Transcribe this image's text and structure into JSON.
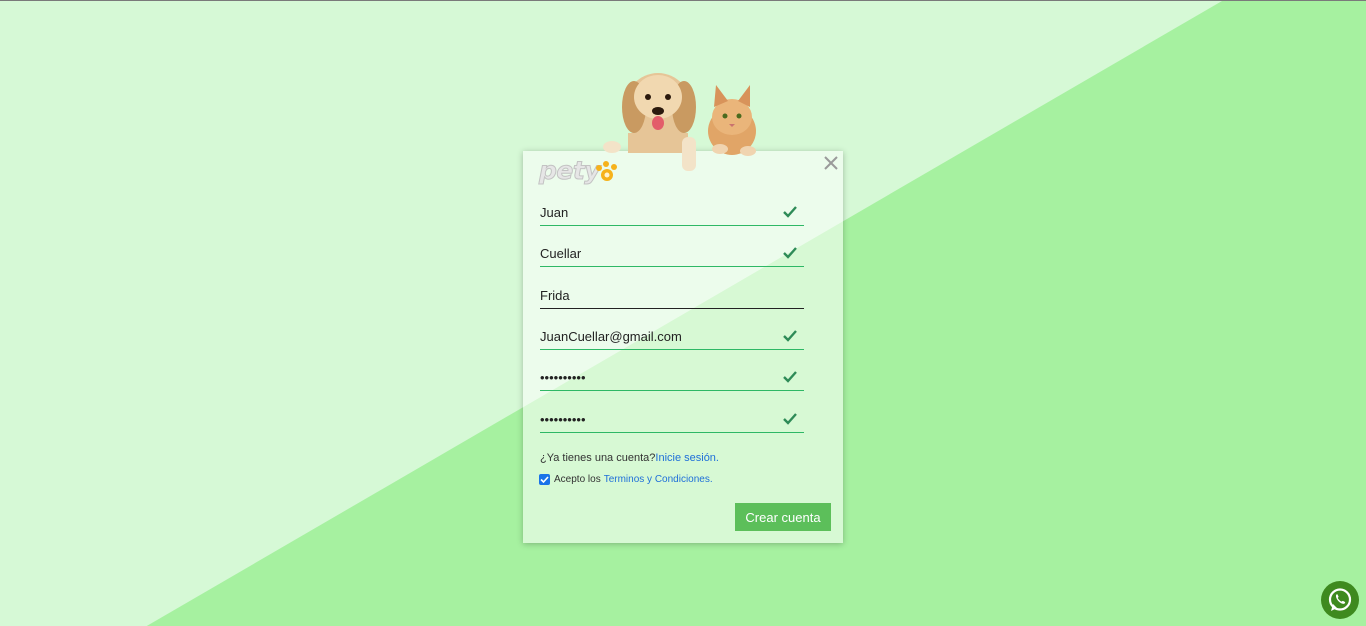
{
  "brand": {
    "logo_text": "pety",
    "accent": "#5cbf5a",
    "background_light": "#d6f9d6",
    "background_dark": "#a6f1a0"
  },
  "form": {
    "fields": [
      {
        "value": "Juan",
        "valid": true
      },
      {
        "value": "Cuellar",
        "valid": true
      },
      {
        "value": "Frida",
        "valid": false
      },
      {
        "value": "JuanCuellar@gmail.com",
        "valid": true
      },
      {
        "value": "••••••••••",
        "valid": true
      },
      {
        "value": "••••••••••",
        "valid": true
      }
    ],
    "have_account_text": "¿Ya tienes una cuenta?",
    "login_link": "Inicie sesión.",
    "terms_prefix": "Acepto los",
    "terms_link": "Terminos y Condiciones.",
    "terms_checked": true,
    "submit_label": "Crear cuenta"
  },
  "icons": {
    "close": "close-icon",
    "check": "check-icon",
    "whatsapp": "whatsapp-icon"
  }
}
